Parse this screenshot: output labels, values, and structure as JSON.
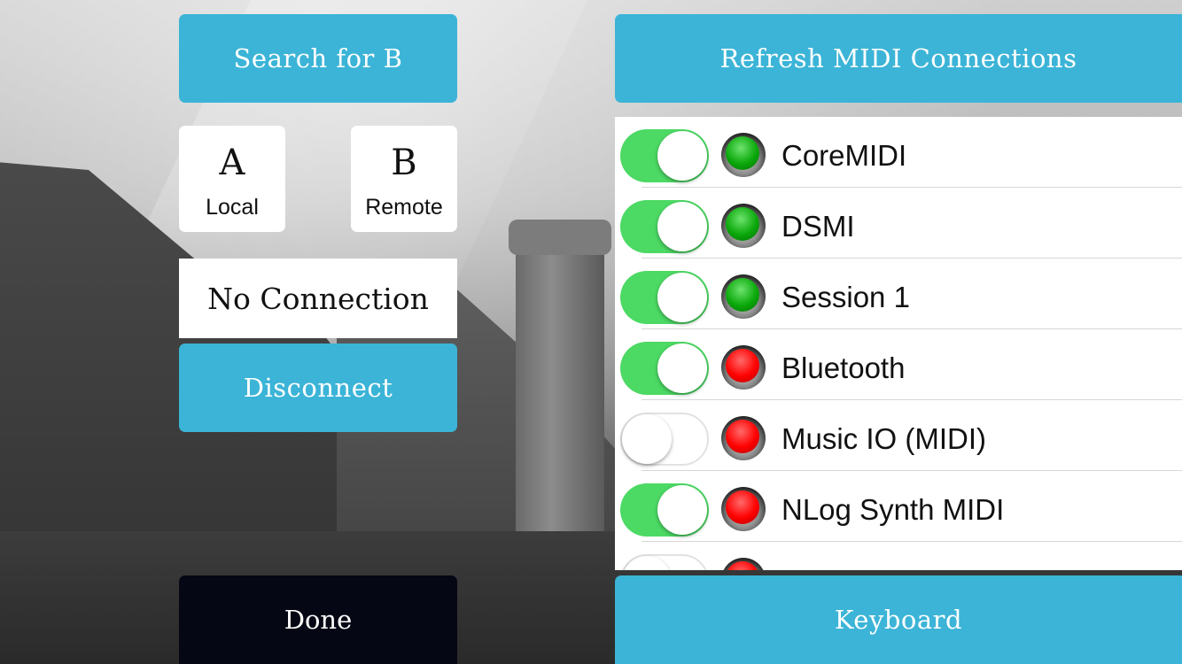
{
  "buttons": {
    "search": "Search for B",
    "refresh": "Refresh MIDI Connections",
    "disconnect": "Disconnect",
    "done": "Done",
    "keyboard": "Keyboard"
  },
  "peers": {
    "a": {
      "letter": "A",
      "label": "Local"
    },
    "b": {
      "letter": "B",
      "label": "Remote"
    }
  },
  "status": "No Connection",
  "colors": {
    "accent": "#3bb4d7",
    "toggle_on": "#4cd964",
    "led_green": "#0aa80a",
    "led_red": "#ff0000",
    "done_bg": "#050714"
  },
  "midi_connections": [
    {
      "name": "CoreMIDI",
      "enabled": true,
      "status": "green"
    },
    {
      "name": "DSMI",
      "enabled": true,
      "status": "green"
    },
    {
      "name": "Session 1",
      "enabled": true,
      "status": "green"
    },
    {
      "name": "Bluetooth",
      "enabled": true,
      "status": "red"
    },
    {
      "name": "Music IO (MIDI)",
      "enabled": false,
      "status": "red"
    },
    {
      "name": "NLog Synth MIDI",
      "enabled": true,
      "status": "red"
    },
    {
      "name": "",
      "enabled": false,
      "status": "red"
    }
  ]
}
